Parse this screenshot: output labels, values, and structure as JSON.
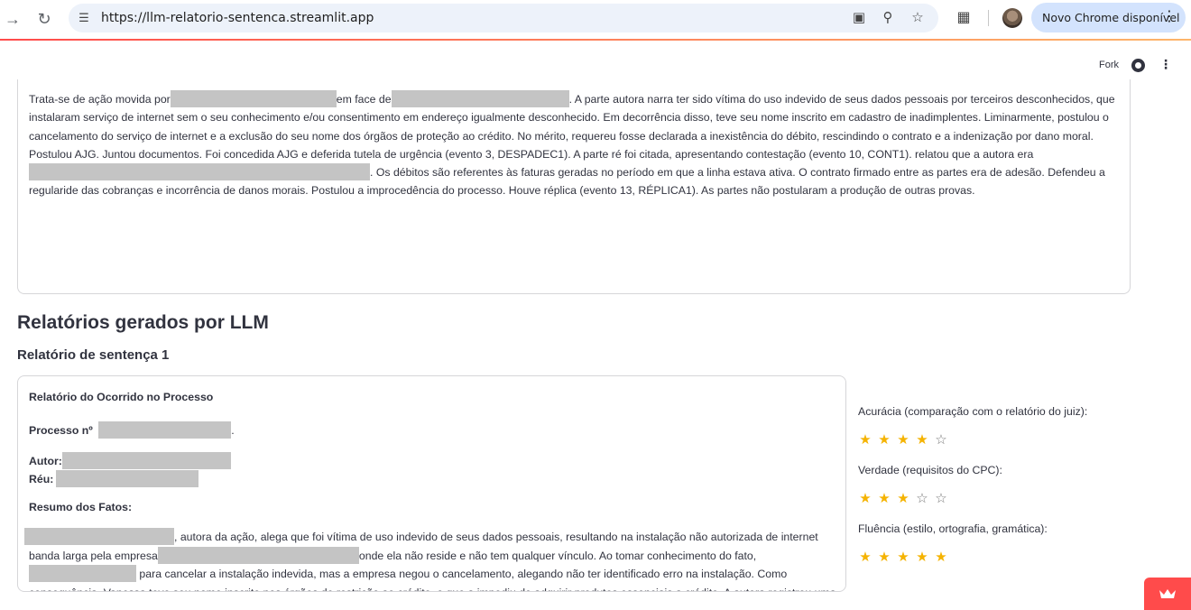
{
  "browser": {
    "url": "https://llm-relatorio-sentenca.streamlit.app",
    "update_label": "Novo Chrome disponível"
  },
  "header": {
    "fork_label": "Fork"
  },
  "case_text": {
    "s1": "Trata-se de ação movida por",
    "s2": "em face de",
    "s3": ". A parte autora narra ter sido vítima do uso indevido de seus dados pessoais por terceiros desconhecidos, que instalaram serviço de internet sem o seu conhecimento e/ou consentimento em endereço igualmente desconhecido. Em decorrência disso, teve seu nome inscrito em cadastro de inadimplentes. Liminarmente, postulou o cancelamento do serviço de internet e a exclusão do seu nome dos órgãos de proteção ao crédito. No mérito, requereu fosse declarada a inexistência do débito, rescindindo o contrato e a indenização por dano moral. Postulou AJG. Juntou documentos. Foi concedida AJG e deferida tutela de urgência (evento 3, DESPADEC1). A parte ré foi citada, apresentando contestação (evento 10, CONT1). relatou que a autora era",
    "s4": ". Os débitos são referentes às faturas geradas no período em que a linha estava ativa. O contrato firmado entre as partes era de adesão. Defendeu a regularide das cobranças e incorrência de danos morais. Postulou a improcedência do processo. Houve réplica (evento 13, RÉPLICA1). As partes não postularam a produção de outras provas."
  },
  "section_title": "Relatórios gerados por LLM",
  "report": {
    "subtitle": "Relatório de sentença 1",
    "heading": "Relatório do Ocorrido no Processo",
    "processo_label": "Processo nº",
    "autor_label": "Autor:",
    "reu_label": "Réu:",
    "resumo_label": "Resumo dos Fatos:",
    "p1": ", autora da ação, alega que foi vítima de uso indevido de seus dados pessoais, resultando na instalação não autorizada de internet banda larga pela empresa",
    "p2": "onde ela não reside e não tem qualquer vínculo. Ao tomar conhecimento do fato,",
    "p3": "para cancelar a instalação indevida, mas a empresa negou o cancelamento, alegando não ter identificado erro na instalação. Como consequência, Vanessa teve seu nome inscrito nos órgãos de restrição ao crédito, o que a impediu de adquirir produtos essenciais a crédito. A autora registrou uma ocorrência policial, mas não obteve"
  },
  "ratings": [
    {
      "label": "Acurácia (comparação com o relatório do juiz):",
      "value": 4,
      "max": 5
    },
    {
      "label": "Verdade (requisitos do CPC):",
      "value": 3,
      "max": 5
    },
    {
      "label": "Fluência (estilo, ortografia, gramática):",
      "value": 5,
      "max": 5
    }
  ],
  "icons": {
    "back": "arrow-left-icon",
    "reload": "reload-icon",
    "site_info": "tune-icon",
    "install": "install-app-icon",
    "zoom": "zoom-icon",
    "bookmark": "star-icon",
    "extensions": "puzzle-icon",
    "github": "github-icon",
    "menu": "kebab-menu-icon"
  },
  "colors": {
    "accent": "#ff4b4b",
    "star": "#f5b301",
    "pill": "#d3e3fd"
  }
}
